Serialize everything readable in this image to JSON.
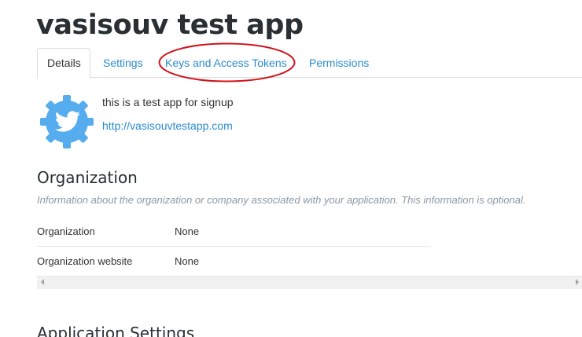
{
  "app": {
    "title": "vasisouv test app",
    "description": "this is a test app for signup",
    "website": "http://vasisouvtestapp.com"
  },
  "tabs": [
    {
      "label": "Details",
      "active": true
    },
    {
      "label": "Settings",
      "active": false
    },
    {
      "label": "Keys and Access Tokens",
      "active": false,
      "highlighted": true
    },
    {
      "label": "Permissions",
      "active": false
    }
  ],
  "organization": {
    "title": "Organization",
    "note": "Information about the organization or company associated with your application. This information is optional.",
    "rows": [
      {
        "key": "Organization",
        "value": "None"
      },
      {
        "key": "Organization website",
        "value": "None"
      }
    ]
  },
  "application_settings": {
    "title": "Application Settings"
  },
  "colors": {
    "link": "#2a8bd0",
    "highlight_ellipse": "#d0121b",
    "twitter_blue": "#55acee"
  },
  "icons": {
    "app_icon": "twitter-bird-gear-icon"
  }
}
